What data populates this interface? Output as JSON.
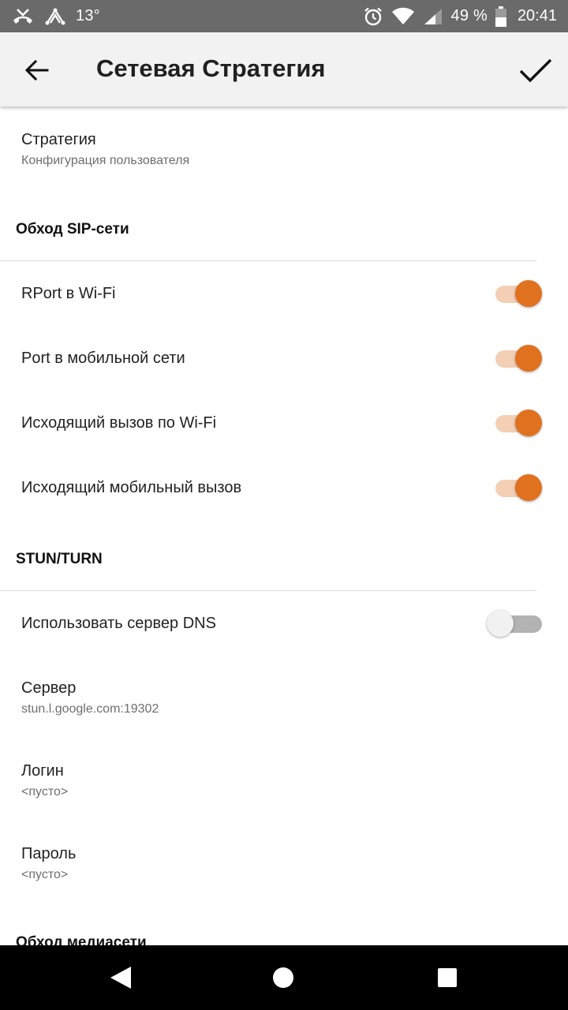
{
  "status_bar": {
    "temperature": "13°",
    "battery": "49 %",
    "time": "20:41",
    "icons": [
      "missed-call-icon",
      "network-sharing-icon",
      "alarm-icon",
      "wifi-icon",
      "signal-icon",
      "battery-icon"
    ]
  },
  "app_bar": {
    "title": "Сетевая Стратегия",
    "back_icon": "arrow-back-icon",
    "confirm_icon": "check-icon"
  },
  "strategy": {
    "title": "Стратегия",
    "summary": "Конфигурация пользователя"
  },
  "sip_section": {
    "header": "Обход SIP-сети",
    "items": [
      {
        "label": "RPort в Wi-Fi",
        "enabled": true
      },
      {
        "label": "Port в мобильной сети",
        "enabled": true
      },
      {
        "label": "Исходящий вызов по Wi-Fi",
        "enabled": true
      },
      {
        "label": "Исходящий мобильный вызов",
        "enabled": true
      }
    ]
  },
  "stun_section": {
    "header": "STUN/TURN",
    "use_dns": {
      "label": "Использовать сервер DNS",
      "enabled": false
    },
    "server": {
      "title": "Сервер",
      "value": "stun.l.google.com:19302"
    },
    "login": {
      "title": "Логин",
      "value": "<пусто>"
    },
    "password": {
      "title": "Пароль",
      "value": "<пусто>"
    }
  },
  "media_section": {
    "header": "Обход медиасети"
  },
  "colors": {
    "accent": "#e0711f",
    "accent_track": "#f3cfb6",
    "status_bar": "#6a6a6a",
    "app_bar": "#f2f2f2"
  }
}
